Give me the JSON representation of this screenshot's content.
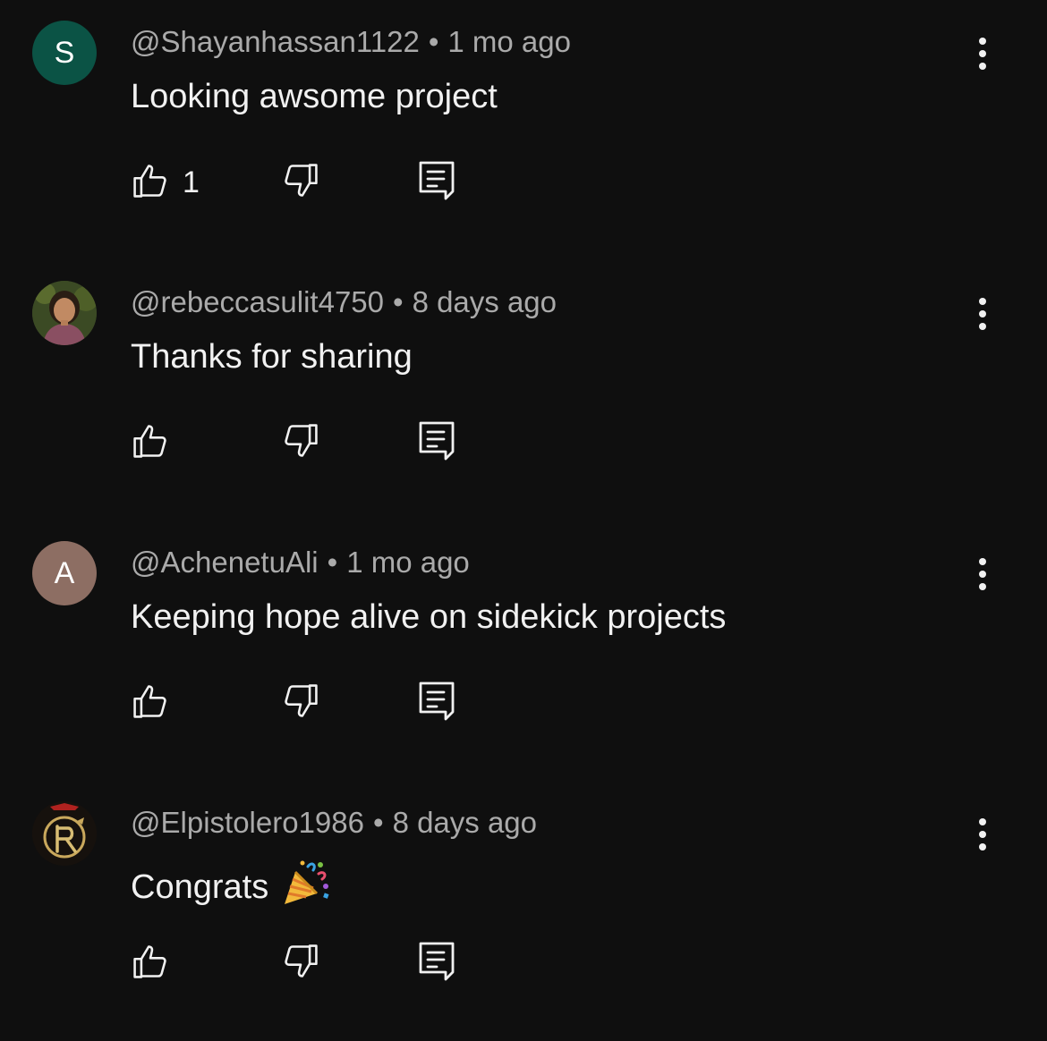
{
  "comments": [
    {
      "handle": "@Shayanhassan1122",
      "separator": "•",
      "time": "1 mo ago",
      "text": "Looking awsome project",
      "likes": "1",
      "avatar": {
        "type": "letter",
        "letter": "S",
        "color": "#0b5345"
      }
    },
    {
      "handle": "@rebeccasulit4750",
      "separator": "•",
      "time": "8 days ago",
      "text": "Thanks for sharing",
      "likes": "",
      "avatar": {
        "type": "photo",
        "description_icon": "person-photo-icon"
      }
    },
    {
      "handle": "@AchenetuAli",
      "separator": "•",
      "time": "1 mo ago",
      "text": "Keeping hope alive on sidekick projects",
      "likes": "",
      "avatar": {
        "type": "letter",
        "letter": "A",
        "color": "#8d6e63"
      }
    },
    {
      "handle": "@Elpistolero1986",
      "separator": "•",
      "time": "8 days ago",
      "text": "Congrats",
      "emoji": "party-popper-icon",
      "likes": "",
      "avatar": {
        "type": "logo",
        "description_icon": "crest-logo-icon"
      }
    }
  ],
  "theme": {
    "background": "#0f0f0f",
    "text": "#f1f1f1",
    "secondary_text": "#aaaaaa"
  }
}
